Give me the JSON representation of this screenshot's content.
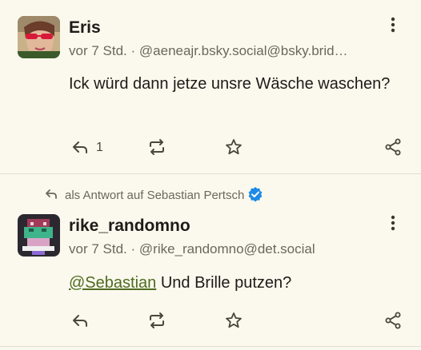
{
  "posts": [
    {
      "author": "Eris",
      "time": "vor 7 Std.",
      "separator": "·",
      "handle": "@aeneajr.bsky.social@bsky.brid…",
      "text": "Ick würd dann jetze unsre Wäsche waschen?",
      "reply_count": "1",
      "avatar_icon": "user-photo-avatar"
    },
    {
      "reply_to_prefix": "als Antwort auf",
      "reply_to_name": "Sebastian Pertsch",
      "author": "rike_randomno",
      "time": "vor 7 Std.",
      "separator": "·",
      "handle": "@rike_randomno@det.social",
      "mention": "@Sebastian",
      "text": " Und Brille putzen?",
      "reply_count": "",
      "avatar_icon": "pixel-art-avatar"
    }
  ],
  "colors": {
    "background": "#fbf9ee",
    "text": "#1d1b16",
    "muted": "#6b675d",
    "mention": "#4f6b21",
    "verified": "#1d8ae6"
  }
}
